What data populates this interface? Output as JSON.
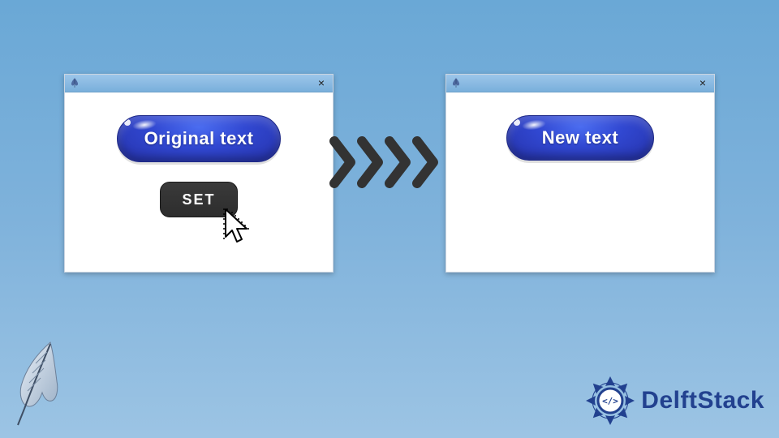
{
  "left_window": {
    "button_label": "Original text",
    "set_label": "SET"
  },
  "right_window": {
    "button_label": "New text"
  },
  "brand": {
    "name": "DelftStack"
  },
  "icons": {
    "close": "×"
  }
}
